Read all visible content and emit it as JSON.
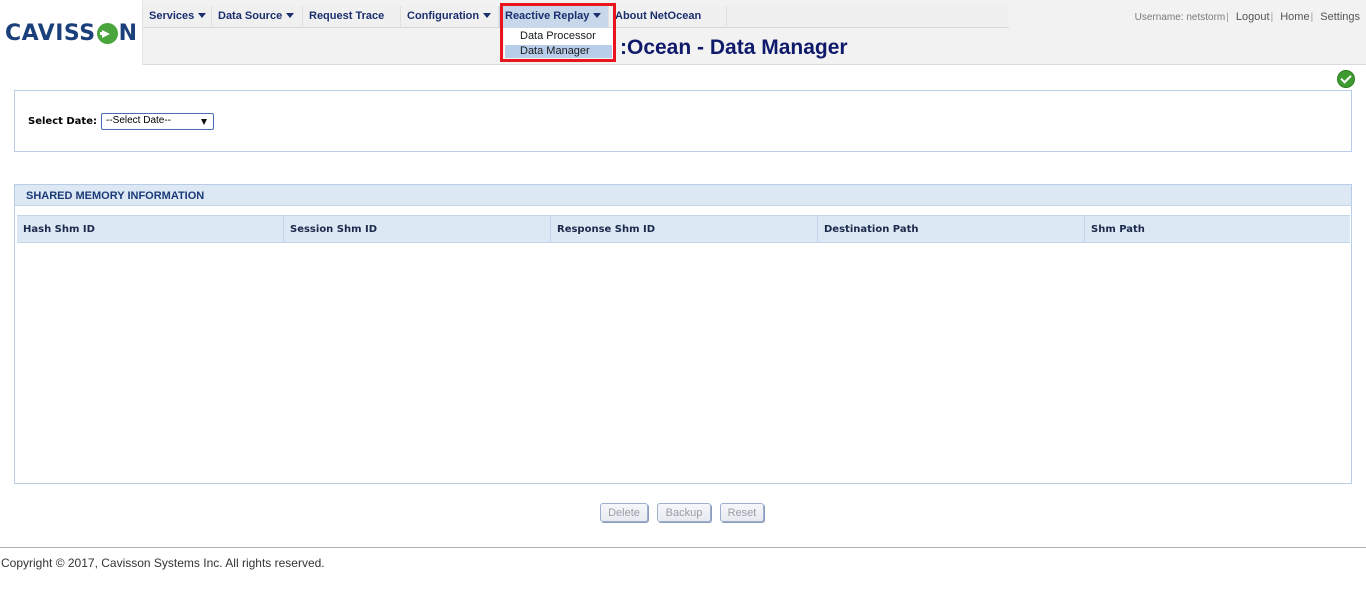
{
  "brand": {
    "logo_text_left": "CAVISS",
    "logo_text_right": "N"
  },
  "menu": {
    "items": [
      {
        "label": "Services",
        "has_caret": true
      },
      {
        "label": "Data Source",
        "has_caret": true
      },
      {
        "label": "Request Trace",
        "has_caret": false
      },
      {
        "label": "Configuration",
        "has_caret": true
      },
      {
        "label": "Reactive Replay",
        "has_caret": true,
        "active": true
      },
      {
        "label": "About NetOcean",
        "has_caret": false
      }
    ],
    "dropdown": [
      {
        "label": "Data Processor",
        "active": false
      },
      {
        "label": "Data Manager",
        "active": true
      }
    ]
  },
  "page": {
    "title": ":Ocean - Data Manager"
  },
  "userbar": {
    "username_text": "Username: netstorm",
    "sep": "|",
    "logout": "Logout",
    "home": "Home",
    "settings": "Settings"
  },
  "date_filter": {
    "label": "Select Date:",
    "selected": "--Select Date--"
  },
  "shm": {
    "title": "SHARED MEMORY INFORMATION",
    "columns": [
      "Hash Shm ID",
      "Session Shm ID",
      "Response Shm ID",
      "Destination Path",
      "Shm Path"
    ],
    "rows": []
  },
  "buttons": {
    "delete": "Delete",
    "backup": "Backup",
    "reset": "Reset"
  },
  "footer": {
    "copyright": "Copyright © 2017, Cavisson Systems Inc. All rights reserved."
  },
  "colors": {
    "accent_navy": "#101a6a",
    "brand_green": "#4aa53c",
    "highlight_red": "#e8141e",
    "panel_border": "#b9cde6",
    "header_fill": "#dde8f5"
  },
  "icons": {
    "status": "check-circle-icon",
    "logo_o": "arrow-circle-icon"
  }
}
